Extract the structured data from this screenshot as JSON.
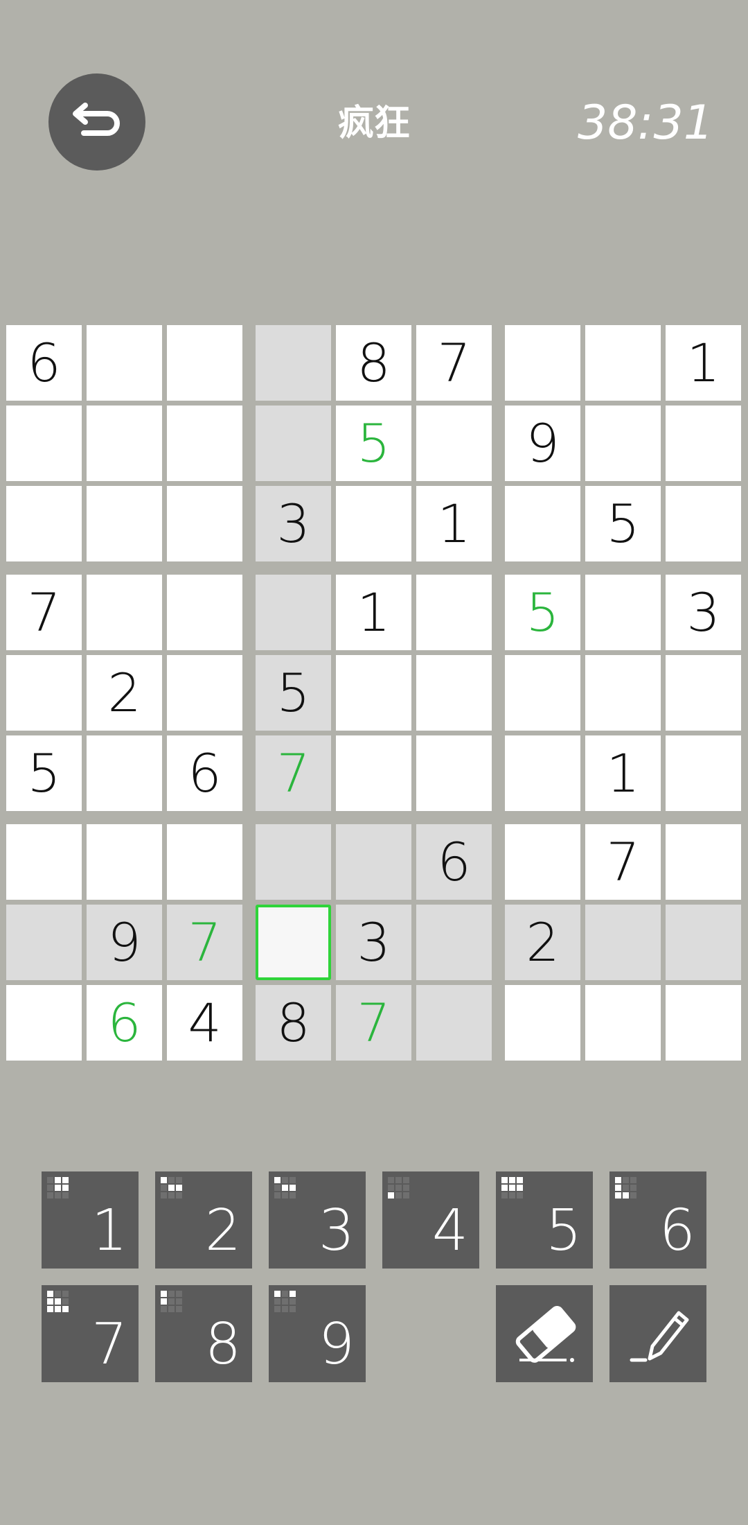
{
  "header": {
    "back_icon": "undo-arrow-icon",
    "difficulty": "疯狂",
    "timer": "38:31"
  },
  "colors": {
    "background": "#b1b1aa",
    "button": "#5b5b5b",
    "given_digit": "#111111",
    "entered_digit": "#2bb53d",
    "selected_border": "#2fd43a",
    "highlight_cell": "#dcdcdc"
  },
  "board": {
    "cells": [
      [
        "6",
        "",
        "",
        "",
        "8",
        "7",
        "",
        "",
        "1"
      ],
      [
        "",
        "",
        "",
        "",
        "5",
        "",
        "9",
        "",
        ""
      ],
      [
        "",
        "",
        "",
        "3",
        "",
        "1",
        "",
        "5",
        ""
      ],
      [
        "7",
        "",
        "",
        "",
        "1",
        "",
        "5",
        "",
        "3"
      ],
      [
        "",
        "2",
        "",
        "5",
        "",
        "",
        "",
        "",
        ""
      ],
      [
        "5",
        "",
        "6",
        "7",
        "",
        "",
        "",
        "1",
        ""
      ],
      [
        "",
        "",
        "",
        "",
        "",
        "6",
        "",
        "7",
        ""
      ],
      [
        "",
        "9",
        "7",
        "",
        "3",
        "",
        "2",
        "",
        ""
      ],
      [
        "",
        "6",
        "4",
        "8",
        "7",
        "",
        "",
        "",
        ""
      ]
    ],
    "user_entered": [
      [
        1,
        4
      ],
      [
        3,
        6
      ],
      [
        5,
        3
      ],
      [
        7,
        2
      ],
      [
        8,
        1
      ],
      [
        8,
        4
      ]
    ],
    "highlighted": [
      [
        0,
        3
      ],
      [
        1,
        3
      ],
      [
        2,
        3
      ],
      [
        3,
        3
      ],
      [
        4,
        3
      ],
      [
        5,
        3
      ],
      [
        6,
        3
      ],
      [
        8,
        3
      ],
      [
        6,
        4
      ],
      [
        6,
        5
      ],
      [
        8,
        4
      ],
      [
        8,
        5
      ],
      [
        7,
        0
      ],
      [
        7,
        1
      ],
      [
        7,
        2
      ],
      [
        7,
        4
      ],
      [
        7,
        5
      ],
      [
        7,
        6
      ],
      [
        7,
        7
      ],
      [
        7,
        8
      ]
    ],
    "selected": [
      7,
      3
    ]
  },
  "keypad": {
    "digits": [
      {
        "label": "1",
        "remaining_pattern": [
          0,
          1,
          1,
          0,
          1,
          1,
          0,
          0,
          0
        ]
      },
      {
        "label": "2",
        "remaining_pattern": [
          1,
          0,
          0,
          0,
          1,
          1,
          0,
          0,
          0
        ]
      },
      {
        "label": "3",
        "remaining_pattern": [
          1,
          0,
          0,
          0,
          1,
          1,
          0,
          0,
          0
        ]
      },
      {
        "label": "4",
        "remaining_pattern": [
          0,
          0,
          0,
          0,
          0,
          0,
          1,
          0,
          0
        ]
      },
      {
        "label": "5",
        "remaining_pattern": [
          1,
          1,
          1,
          1,
          1,
          1,
          0,
          0,
          0
        ]
      },
      {
        "label": "6",
        "remaining_pattern": [
          1,
          0,
          0,
          1,
          0,
          0,
          1,
          1,
          0
        ]
      },
      {
        "label": "7",
        "remaining_pattern": [
          1,
          0,
          0,
          1,
          1,
          0,
          1,
          1,
          1
        ]
      },
      {
        "label": "8",
        "remaining_pattern": [
          1,
          0,
          0,
          1,
          0,
          0,
          0,
          0,
          0
        ]
      },
      {
        "label": "9",
        "remaining_pattern": [
          1,
          0,
          1,
          0,
          0,
          0,
          0,
          0,
          0
        ]
      }
    ],
    "tools": [
      {
        "name": "eraser",
        "icon": "eraser-icon"
      },
      {
        "name": "pencil",
        "icon": "pencil-icon"
      }
    ]
  }
}
